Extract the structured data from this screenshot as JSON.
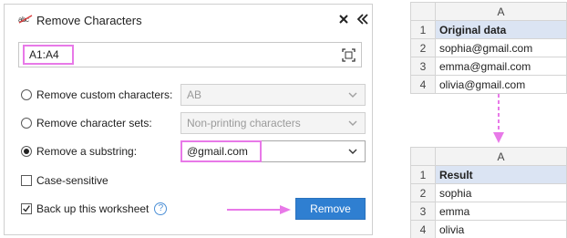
{
  "dialog": {
    "title": "Remove Characters",
    "range": "A1:A4",
    "options": {
      "custom_label": "Remove custom characters:",
      "custom_value": "AB",
      "sets_label": "Remove character sets:",
      "sets_value": "Non-printing characters",
      "substring_label": "Remove a substring:",
      "substring_value": "@gmail.com",
      "selected": "substring"
    },
    "case_sensitive": {
      "label": "Case-sensitive",
      "checked": false
    },
    "backup": {
      "label": "Back up this worksheet",
      "checked": true
    },
    "remove_label": "Remove",
    "accent": "#2f7fd1",
    "highlight": "#e879e8"
  },
  "sheet_original": {
    "column": "A",
    "rows": [
      {
        "n": "1",
        "value": "Original data"
      },
      {
        "n": "2",
        "value": "sophia@gmail.com"
      },
      {
        "n": "3",
        "value": "emma@gmail.com"
      },
      {
        "n": "4",
        "value": "olivia@gmail.com"
      }
    ]
  },
  "sheet_result": {
    "column": "A",
    "rows": [
      {
        "n": "1",
        "value": "Result"
      },
      {
        "n": "2",
        "value": "sophia"
      },
      {
        "n": "3",
        "value": "emma"
      },
      {
        "n": "4",
        "value": "olivia"
      }
    ]
  }
}
